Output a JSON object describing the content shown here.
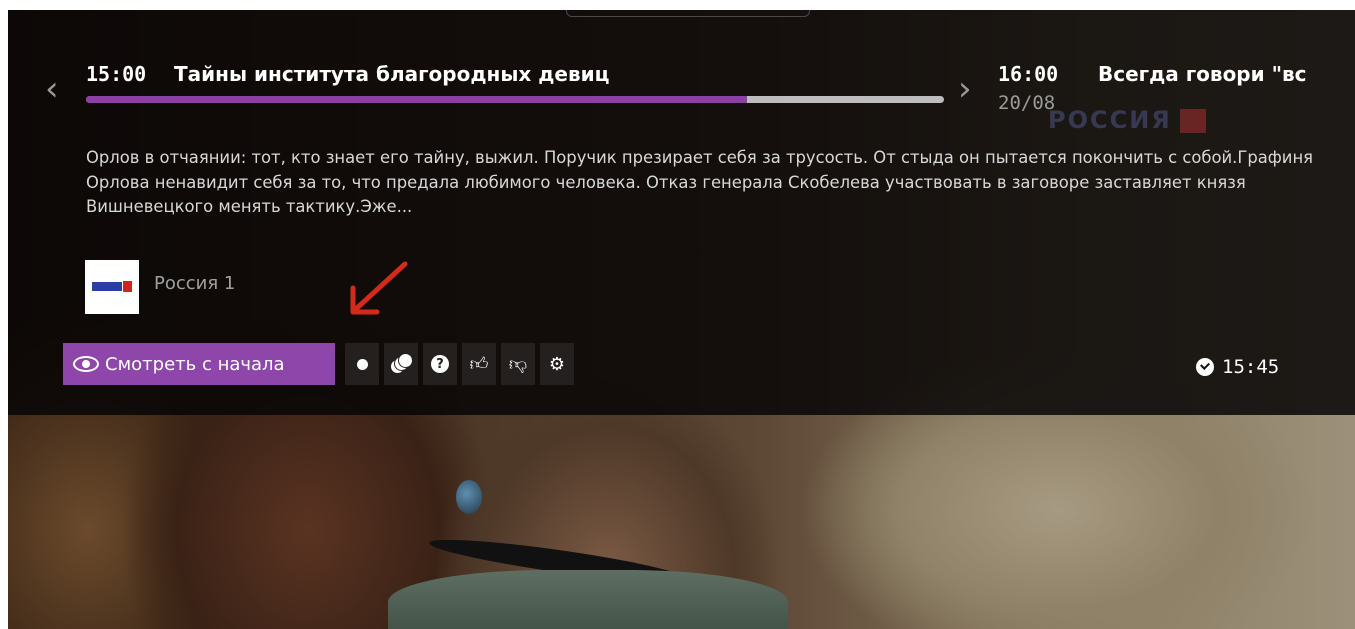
{
  "current_program": {
    "time": "15:00",
    "title": "Тайны института благородных девиц",
    "progress": 0.77,
    "description": "Орлов в отчаянии: тот, кто знает его тайну, выжил. Поручик презирает себя за трусость. От стыда он пытается покончить с собой.Графиня Орлова ненавидит себя за то, что предала любимого человека. Отказ генерала Скобелева участвовать в заговоре заставляет князя Вишневецкого менять тактику.Эже..."
  },
  "next_program": {
    "time": "16:00",
    "title": "Всегда говори \"вс",
    "date": "20/08"
  },
  "channel": {
    "name": "Россия 1"
  },
  "watermark": {
    "text": "РОССИЯ"
  },
  "toolbar": {
    "watch_from_start_label": "Смотреть с начала",
    "icons": [
      "record-dot-icon",
      "coins-icon",
      "help-icon",
      "thumbs-up-icon",
      "thumbs-down-icon",
      "settings-gear-icon"
    ]
  },
  "clock": {
    "time": "15:45"
  },
  "colors": {
    "accent_purple": "#8e46aa",
    "progress_fill": "#8e3fa3",
    "annotation_arrow": "#d42a1a"
  }
}
